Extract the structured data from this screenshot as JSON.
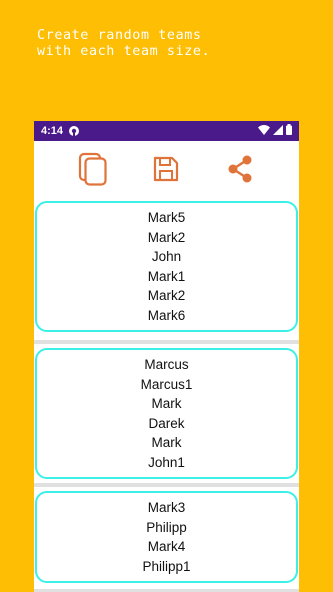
{
  "promo": {
    "text": "Create random teams\nwith each team size."
  },
  "statusbar": {
    "time": "4:14"
  },
  "toolbar": {
    "icons": [
      "copy-icon",
      "save-icon",
      "share-icon"
    ],
    "accent": "#E0733A"
  },
  "teams": [
    {
      "members": [
        "Mark5",
        "Mark2",
        "John",
        "Mark1",
        "Mark2",
        "Mark6"
      ]
    },
    {
      "members": [
        "Marcus",
        "Marcus1",
        "Mark",
        "Darek",
        "Mark",
        "John1"
      ]
    },
    {
      "members": [
        "Mark3",
        "Philipp",
        "Mark4",
        "Philipp1"
      ]
    }
  ],
  "colors": {
    "background": "#FDBE03",
    "statusbar": "#4B1A8A",
    "card_border": "#3CF0E8",
    "divider": "#E0E0E0"
  }
}
